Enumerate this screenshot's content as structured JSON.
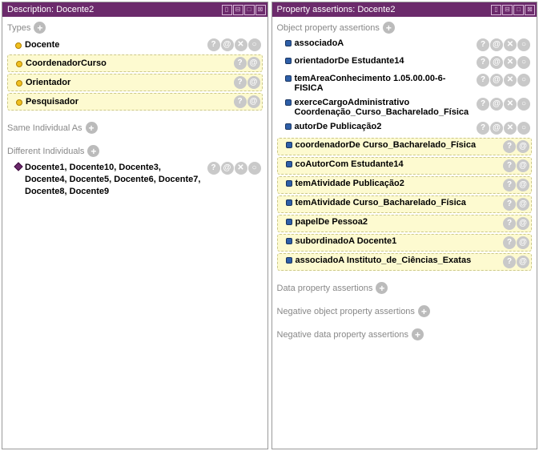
{
  "left": {
    "title": "Description: Docente2",
    "sections": {
      "types": {
        "label": "Types",
        "entries": [
          {
            "text": "Docente",
            "inferred": false
          },
          {
            "text": "CoordenadorCurso",
            "inferred": true
          },
          {
            "text": "Orientador",
            "inferred": true
          },
          {
            "text": "Pesquisador",
            "inferred": true
          }
        ]
      },
      "same": {
        "label": "Same Individual As"
      },
      "diff": {
        "label": "Different Individuals",
        "text": "Docente1, Docente10, Docente3, Docente4, Docente5, Docente6, Docente7, Docente8, Docente9"
      }
    }
  },
  "right": {
    "title": "Property assertions: Docente2",
    "sections": {
      "obj": {
        "label": "Object property assertions",
        "entries": [
          {
            "prop": "associadoA",
            "val": "",
            "inferred": false
          },
          {
            "prop": "orientadorDe",
            "val": "Estudante14",
            "inferred": false
          },
          {
            "prop": "temAreaConhecimento",
            "val": "1.05.00.00-6-FISICA",
            "inferred": false
          },
          {
            "prop": "exerceCargoAdministrativo",
            "val": "Coordenação_Curso_Bacharelado_Física",
            "inferred": false
          },
          {
            "prop": "autorDe",
            "val": "Publicação2",
            "inferred": false
          },
          {
            "prop": "coordenadorDe",
            "val": "Curso_Bacharelado_Física",
            "inferred": true
          },
          {
            "prop": "coAutorCom",
            "val": "Estudante14",
            "inferred": true
          },
          {
            "prop": "temAtividade",
            "val": "Publicação2",
            "inferred": true
          },
          {
            "prop": "temAtividade",
            "val": "Curso_Bacharelado_Física",
            "inferred": true
          },
          {
            "prop": "papelDe",
            "val": "Pessoa2",
            "inferred": true
          },
          {
            "prop": "subordinadoA",
            "val": "Docente1",
            "inferred": true
          },
          {
            "prop": "associadoA",
            "val": "Instituto_de_Ciências_Exatas",
            "inferred": true
          }
        ]
      },
      "data": {
        "label": "Data property assertions"
      },
      "negobj": {
        "label": "Negative object property assertions"
      },
      "negdata": {
        "label": "Negative data property assertions"
      }
    }
  },
  "icons": {
    "hdr": [
      "▫",
      "▫",
      "▫",
      "✕"
    ],
    "actions": {
      "help": "?",
      "explain": "@",
      "delete": "✕",
      "ring": "○"
    }
  }
}
